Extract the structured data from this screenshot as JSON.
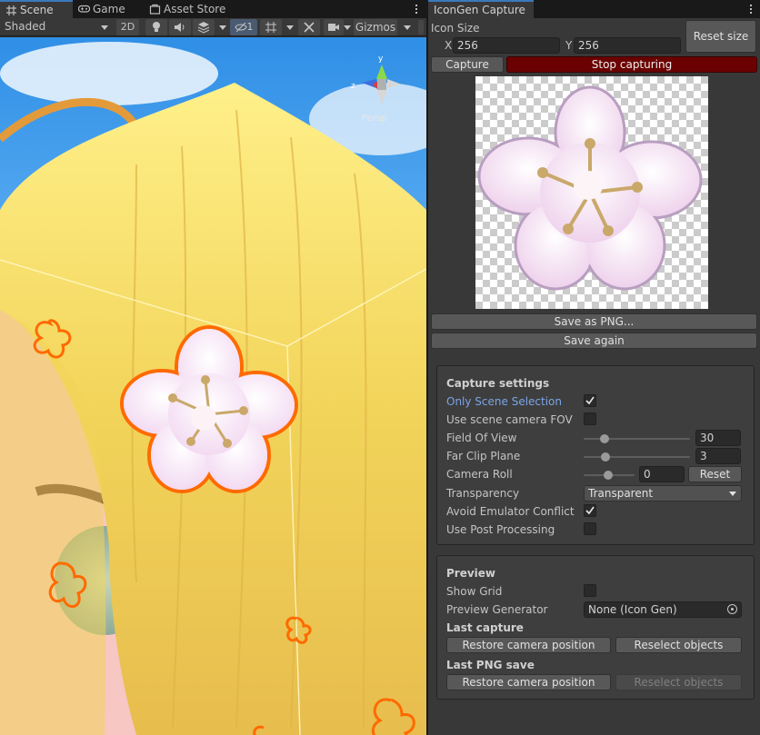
{
  "scene": {
    "tabs": [
      {
        "label": "Scene",
        "icon": "grid-icon",
        "active": true
      },
      {
        "label": "Game",
        "icon": "gamepad-icon",
        "active": false
      },
      {
        "label": "Asset Store",
        "icon": "bag-icon",
        "active": false
      }
    ],
    "toolbar": {
      "shading_mode": "Shaded",
      "mode_2d": "2D",
      "hidden_count": "1",
      "gizmos": "Gizmos"
    },
    "orientation_gizmo": {
      "y_label": "y",
      "z_label": "z",
      "view_label": "Persp"
    }
  },
  "icongen": {
    "tab_title": "IconGen Capture",
    "icon_size_label": "Icon Size",
    "x_label": "X",
    "x_value": "256",
    "y_label": "Y",
    "y_value": "256",
    "reset_size": "Reset size",
    "capture": "Capture",
    "stop_capturing": "Stop capturing",
    "save_as_png": "Save as PNG...",
    "save_again": "Save again",
    "capture_settings": {
      "header": "Capture settings",
      "only_scene_selection": {
        "label": "Only Scene Selection",
        "checked": true
      },
      "use_scene_camera_fov": {
        "label": "Use scene camera FOV",
        "checked": false
      },
      "field_of_view": {
        "label": "Field Of View",
        "value": "30",
        "slider_fraction": 0.18
      },
      "far_clip_plane": {
        "label": "Far Clip Plane",
        "value": "3",
        "slider_fraction": 0.2
      },
      "camera_roll": {
        "label": "Camera Roll",
        "value": "0",
        "slider_fraction": 0.5,
        "reset": "Reset"
      },
      "transparency": {
        "label": "Transparency",
        "value": "Transparent"
      },
      "avoid_emulator_conflict": {
        "label": "Avoid Emulator Conflict",
        "checked": true
      },
      "use_post_processing": {
        "label": "Use Post Processing",
        "checked": false
      }
    },
    "preview": {
      "header": "Preview",
      "show_grid": {
        "label": "Show Grid",
        "checked": false
      },
      "preview_generator": {
        "label": "Preview Generator",
        "value": "None (Icon Gen)"
      },
      "last_capture": {
        "header": "Last capture",
        "restore": "Restore camera position",
        "reselect": "Reselect objects"
      },
      "last_png_save": {
        "header": "Last PNG save",
        "restore": "Restore camera position",
        "reselect": "Reselect objects"
      }
    }
  },
  "colors": {
    "accent_blue": "#7aa5e8",
    "stop_red": "#6b0000",
    "selection_orange": "#ff6a00",
    "hair_yellow": "#f2d45a"
  }
}
